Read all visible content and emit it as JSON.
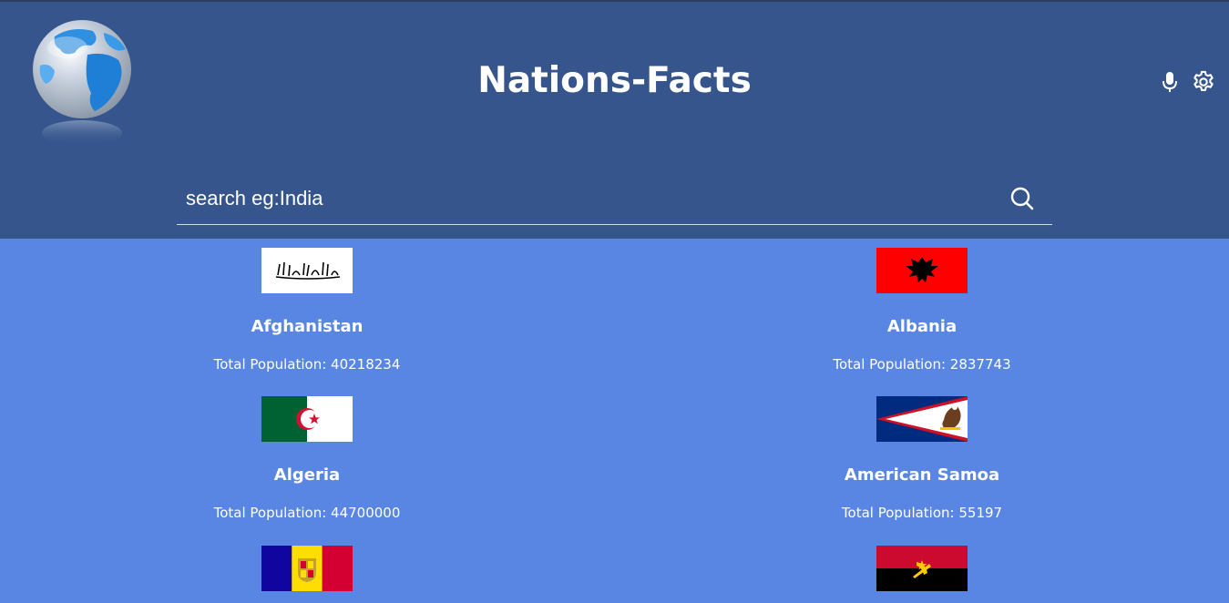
{
  "header": {
    "title": "Nations-Facts",
    "logo_icon": "globe-icon",
    "mic_icon": "microphone-icon",
    "settings_icon": "gear-icon"
  },
  "search": {
    "placeholder": "search eg:India",
    "icon": "search-icon"
  },
  "colors": {
    "header_bg": "#35558c",
    "page_bg": "#5886e2",
    "text": "#ffffff"
  },
  "countries": [
    {
      "name": "Afghanistan",
      "population": "Total Population: 40218234",
      "flag": "afghanistan-flag"
    },
    {
      "name": "Albania",
      "population": "Total Population: 2837743",
      "flag": "albania-flag"
    },
    {
      "name": "Algeria",
      "population": "Total Population: 44700000",
      "flag": "algeria-flag"
    },
    {
      "name": "American Samoa",
      "population": "Total Population: 55197",
      "flag": "american-samoa-flag"
    },
    {
      "name": "",
      "population": "",
      "flag": "andorra-flag"
    },
    {
      "name": "",
      "population": "",
      "flag": "angola-flag"
    }
  ]
}
